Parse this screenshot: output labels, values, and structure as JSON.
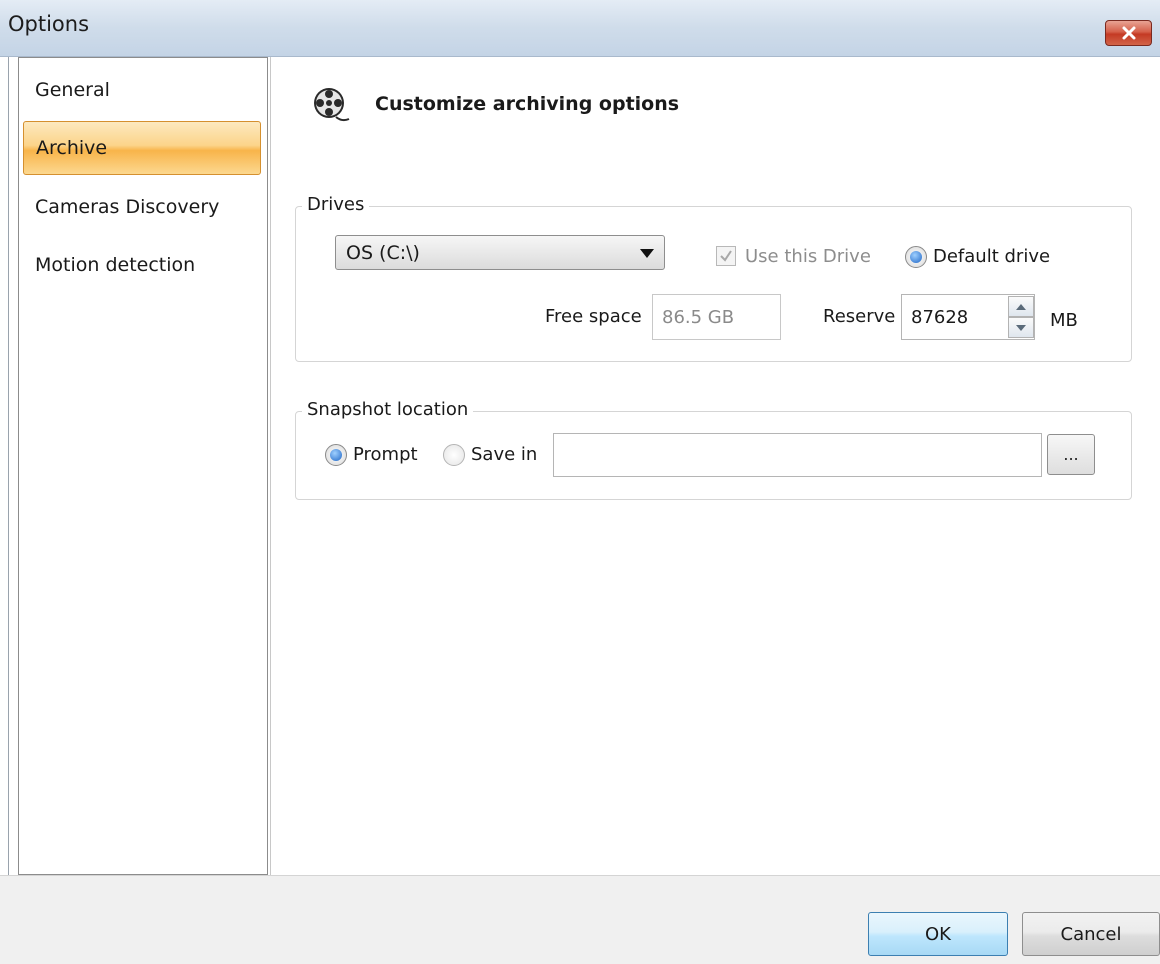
{
  "window": {
    "title": "Options"
  },
  "sidebar": {
    "items": [
      {
        "label": "General"
      },
      {
        "label": "Archive"
      },
      {
        "label": "Cameras Discovery"
      },
      {
        "label": "Motion detection"
      }
    ],
    "selected": "Archive"
  },
  "main": {
    "heading": "Customize archiving options",
    "heading_icon": "film-reel-icon",
    "drives": {
      "legend": "Drives",
      "selected_drive": "OS (C:\\)",
      "use_this_drive_label": "Use this Drive",
      "use_this_drive_checked": true,
      "default_drive_label": "Default drive",
      "default_drive_selected": true,
      "free_space_label": "Free space",
      "free_space_value": "86.5 GB",
      "reserve_label": "Reserve",
      "reserve_value": "87628",
      "reserve_unit": "MB"
    },
    "snapshot": {
      "legend": "Snapshot location",
      "prompt_label": "Prompt",
      "prompt_selected": true,
      "save_in_label": "Save in",
      "save_in_selected": false,
      "path_value": "",
      "browse_label": "..."
    }
  },
  "footer": {
    "ok_label": "OK",
    "cancel_label": "Cancel"
  },
  "colors": {
    "selected_nav": "#f8b44a",
    "close_button": "#c43a24",
    "ok_button": "#bee6fd",
    "radio_on": "#1f66c6"
  }
}
